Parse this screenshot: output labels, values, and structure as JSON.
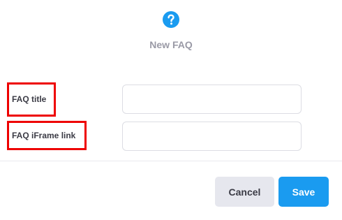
{
  "dialog": {
    "icon": "help-circle-icon",
    "title": "New FAQ"
  },
  "form": {
    "fields": [
      {
        "label": "FAQ title",
        "value": "",
        "placeholder": ""
      },
      {
        "label": "FAQ iFrame link",
        "value": "",
        "placeholder": ""
      }
    ]
  },
  "footer": {
    "cancel_label": "Cancel",
    "save_label": "Save"
  },
  "colors": {
    "accent": "#1a9bf0",
    "highlight": "#ee0000",
    "cancel_bg": "#e6e7ee",
    "title_text": "#9a9aa6"
  }
}
